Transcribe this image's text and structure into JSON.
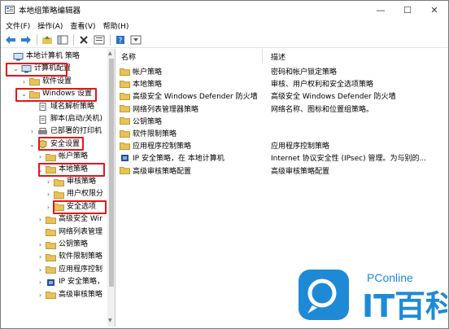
{
  "window": {
    "title": "本地组策略编辑器"
  },
  "title_buttons": {
    "minimize": "—",
    "maximize": "☐",
    "close": "✕"
  },
  "menu": [
    "文件(F)",
    "操作(A)",
    "查看(V)",
    "帮助(H)"
  ],
  "toolbar": {
    "buttons": [
      "back-arrow-icon",
      "forward-arrow-icon",
      "up-folder-icon",
      "show-hide-tree-icon",
      "delete-icon",
      "properties-icon",
      "help-icon",
      "filter-icon"
    ]
  },
  "tree": [
    {
      "label": "本地计算机 策略",
      "indent": 0,
      "expand": "",
      "icon": "computer"
    },
    {
      "label": "计算机配置",
      "indent": 1,
      "expand": "open",
      "icon": "computer"
    },
    {
      "label": "软件设置",
      "indent": 2,
      "expand": "closed",
      "icon": "folder"
    },
    {
      "label": "Windows 设置",
      "indent": 2,
      "expand": "open",
      "icon": "folder"
    },
    {
      "label": "域名解析策略",
      "indent": 3,
      "expand": "",
      "icon": "doc"
    },
    {
      "label": "脚本(启动/关机)",
      "indent": 3,
      "expand": "",
      "icon": "doc"
    },
    {
      "label": "已部署的打印机",
      "indent": 3,
      "expand": "closed",
      "icon": "printer"
    },
    {
      "label": "安全设置",
      "indent": 3,
      "expand": "open",
      "icon": "shield"
    },
    {
      "label": "帐户策略",
      "indent": 4,
      "expand": "closed",
      "icon": "folder"
    },
    {
      "label": "本地策略",
      "indent": 4,
      "expand": "open",
      "icon": "folder"
    },
    {
      "label": "审核策略",
      "indent": 5,
      "expand": "closed",
      "icon": "folder"
    },
    {
      "label": "用户权限分",
      "indent": 5,
      "expand": "closed",
      "icon": "folder"
    },
    {
      "label": "安全选项",
      "indent": 5,
      "expand": "closed",
      "icon": "folder"
    },
    {
      "label": "高级安全 Wir",
      "indent": 4,
      "expand": "closed",
      "icon": "folder"
    },
    {
      "label": "网络列表管理",
      "indent": 4,
      "expand": "",
      "icon": "folder"
    },
    {
      "label": "公钥策略",
      "indent": 4,
      "expand": "closed",
      "icon": "folder"
    },
    {
      "label": "软件限制策略",
      "indent": 4,
      "expand": "closed",
      "icon": "folder"
    },
    {
      "label": "应用程序控制",
      "indent": 4,
      "expand": "closed",
      "icon": "folder"
    },
    {
      "label": "IP 安全策略，",
      "indent": 4,
      "expand": "closed",
      "icon": "ipsec"
    },
    {
      "label": "高级审核策略",
      "indent": 4,
      "expand": "closed",
      "icon": "folder"
    }
  ],
  "list": {
    "columns": [
      "名称",
      "描述"
    ],
    "rows": [
      {
        "name": "帐户策略",
        "desc": "密码和帐户锁定策略",
        "icon": "folder"
      },
      {
        "name": "本地策略",
        "desc": "审核、用户权利和安全选项策略",
        "icon": "folder"
      },
      {
        "name": "高级安全 Windows Defender 防火墙",
        "desc": "高级安全 Windows Defender 防火墙",
        "icon": "folder"
      },
      {
        "name": "网络列表管理器策略",
        "desc": "网络名称、图标和位置组策略。",
        "icon": "folder"
      },
      {
        "name": "公钥策略",
        "desc": "",
        "icon": "folder"
      },
      {
        "name": "软件限制策略",
        "desc": "",
        "icon": "folder"
      },
      {
        "name": "应用程序控制策略",
        "desc": "应用程序控制策略",
        "icon": "folder"
      },
      {
        "name": "IP 安全策略，在 本地计算机",
        "desc": "Internet 协议安全性 (IPsec) 管理。为与别的...",
        "icon": "ipsec"
      },
      {
        "name": "高级审核策略配置",
        "desc": "高级审核策略配置",
        "icon": "folder"
      }
    ]
  },
  "watermark": {
    "brand_small": "PConline",
    "brand_big": "IT百科"
  },
  "colors": {
    "highlight": "#e8131a",
    "folder": "#e8c25a",
    "accent": "#1a73c8",
    "watermark": "#1e8ad6"
  }
}
